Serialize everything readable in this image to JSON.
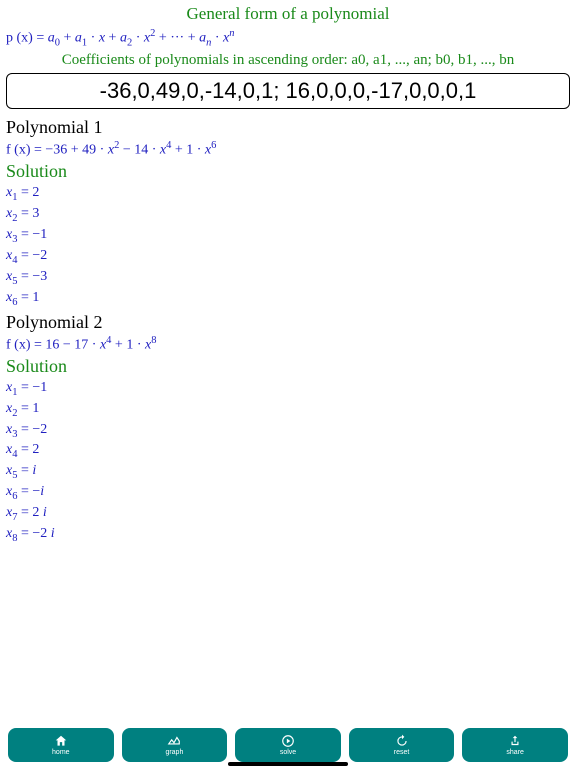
{
  "title": "General form of a polynomial",
  "general_form": {
    "lhs": "p (x) = ",
    "terms": "a₀ + a₁ · x + a₂ · x² + ··· + aₙ · xⁿ"
  },
  "coeff_label": "Coefficients of polynomials in ascending order: a0, a1, ..., an; b0, b1, ..., bn",
  "input_value": "-36,0,49,0,-14,0,1; 16,0,0,0,-17,0,0,0,1",
  "poly1": {
    "heading": "Polynomial 1",
    "expr_prefix": "f (x) = ",
    "expr": "−36 + 49 · x² − 14 · x⁴ + 1 · x⁶",
    "solution_label": "Solution",
    "roots": [
      {
        "sub": "1",
        "val": "2"
      },
      {
        "sub": "2",
        "val": "3"
      },
      {
        "sub": "3",
        "val": "−1"
      },
      {
        "sub": "4",
        "val": "−2"
      },
      {
        "sub": "5",
        "val": "−3"
      },
      {
        "sub": "6",
        "val": "1"
      }
    ]
  },
  "poly2": {
    "heading": "Polynomial 2",
    "expr_prefix": "f (x) = ",
    "expr": "16 − 17 · x⁴ + 1 · x⁸",
    "solution_label": "Solution",
    "roots": [
      {
        "sub": "1",
        "val": "−1"
      },
      {
        "sub": "2",
        "val": "1"
      },
      {
        "sub": "3",
        "val": "−2"
      },
      {
        "sub": "4",
        "val": "2"
      },
      {
        "sub": "5",
        "val": "i"
      },
      {
        "sub": "6",
        "val": "−i"
      },
      {
        "sub": "7",
        "val": "2 i"
      },
      {
        "sub": "8",
        "val": "−2 i"
      }
    ]
  },
  "tabs": {
    "home": "home",
    "graph": "graph",
    "solve": "solve",
    "reset": "reset",
    "share": "share"
  }
}
